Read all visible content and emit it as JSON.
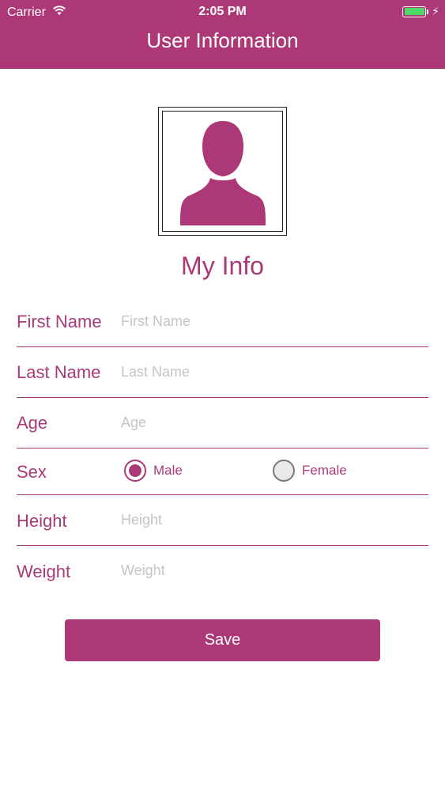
{
  "colors": {
    "brand": "#ad3878",
    "text_accent": "#a93a78",
    "placeholder": "#c4c4c9",
    "battery": "#4cd964"
  },
  "status_bar": {
    "carrier": "Carrier",
    "time": "2:05 PM",
    "wifi_icon": "wifi-icon",
    "battery_icon": "battery-icon",
    "charging_icon": "charging-bolt-icon"
  },
  "nav": {
    "title": "User Information"
  },
  "profile": {
    "avatar_icon": "person-silhouette-icon",
    "heading": "My Info"
  },
  "form": {
    "first_name": {
      "label": "First Name",
      "placeholder": "First Name",
      "value": ""
    },
    "last_name": {
      "label": "Last Name",
      "placeholder": "Last Name",
      "value": ""
    },
    "age": {
      "label": "Age",
      "placeholder": "Age",
      "value": ""
    },
    "sex": {
      "label": "Sex",
      "options": [
        {
          "label": "Male",
          "checked": true
        },
        {
          "label": "Female",
          "checked": false
        }
      ]
    },
    "height": {
      "label": "Height",
      "placeholder": "Height",
      "value": ""
    },
    "weight": {
      "label": "Weight",
      "placeholder": "Weight",
      "value": ""
    }
  },
  "actions": {
    "save_label": "Save"
  }
}
